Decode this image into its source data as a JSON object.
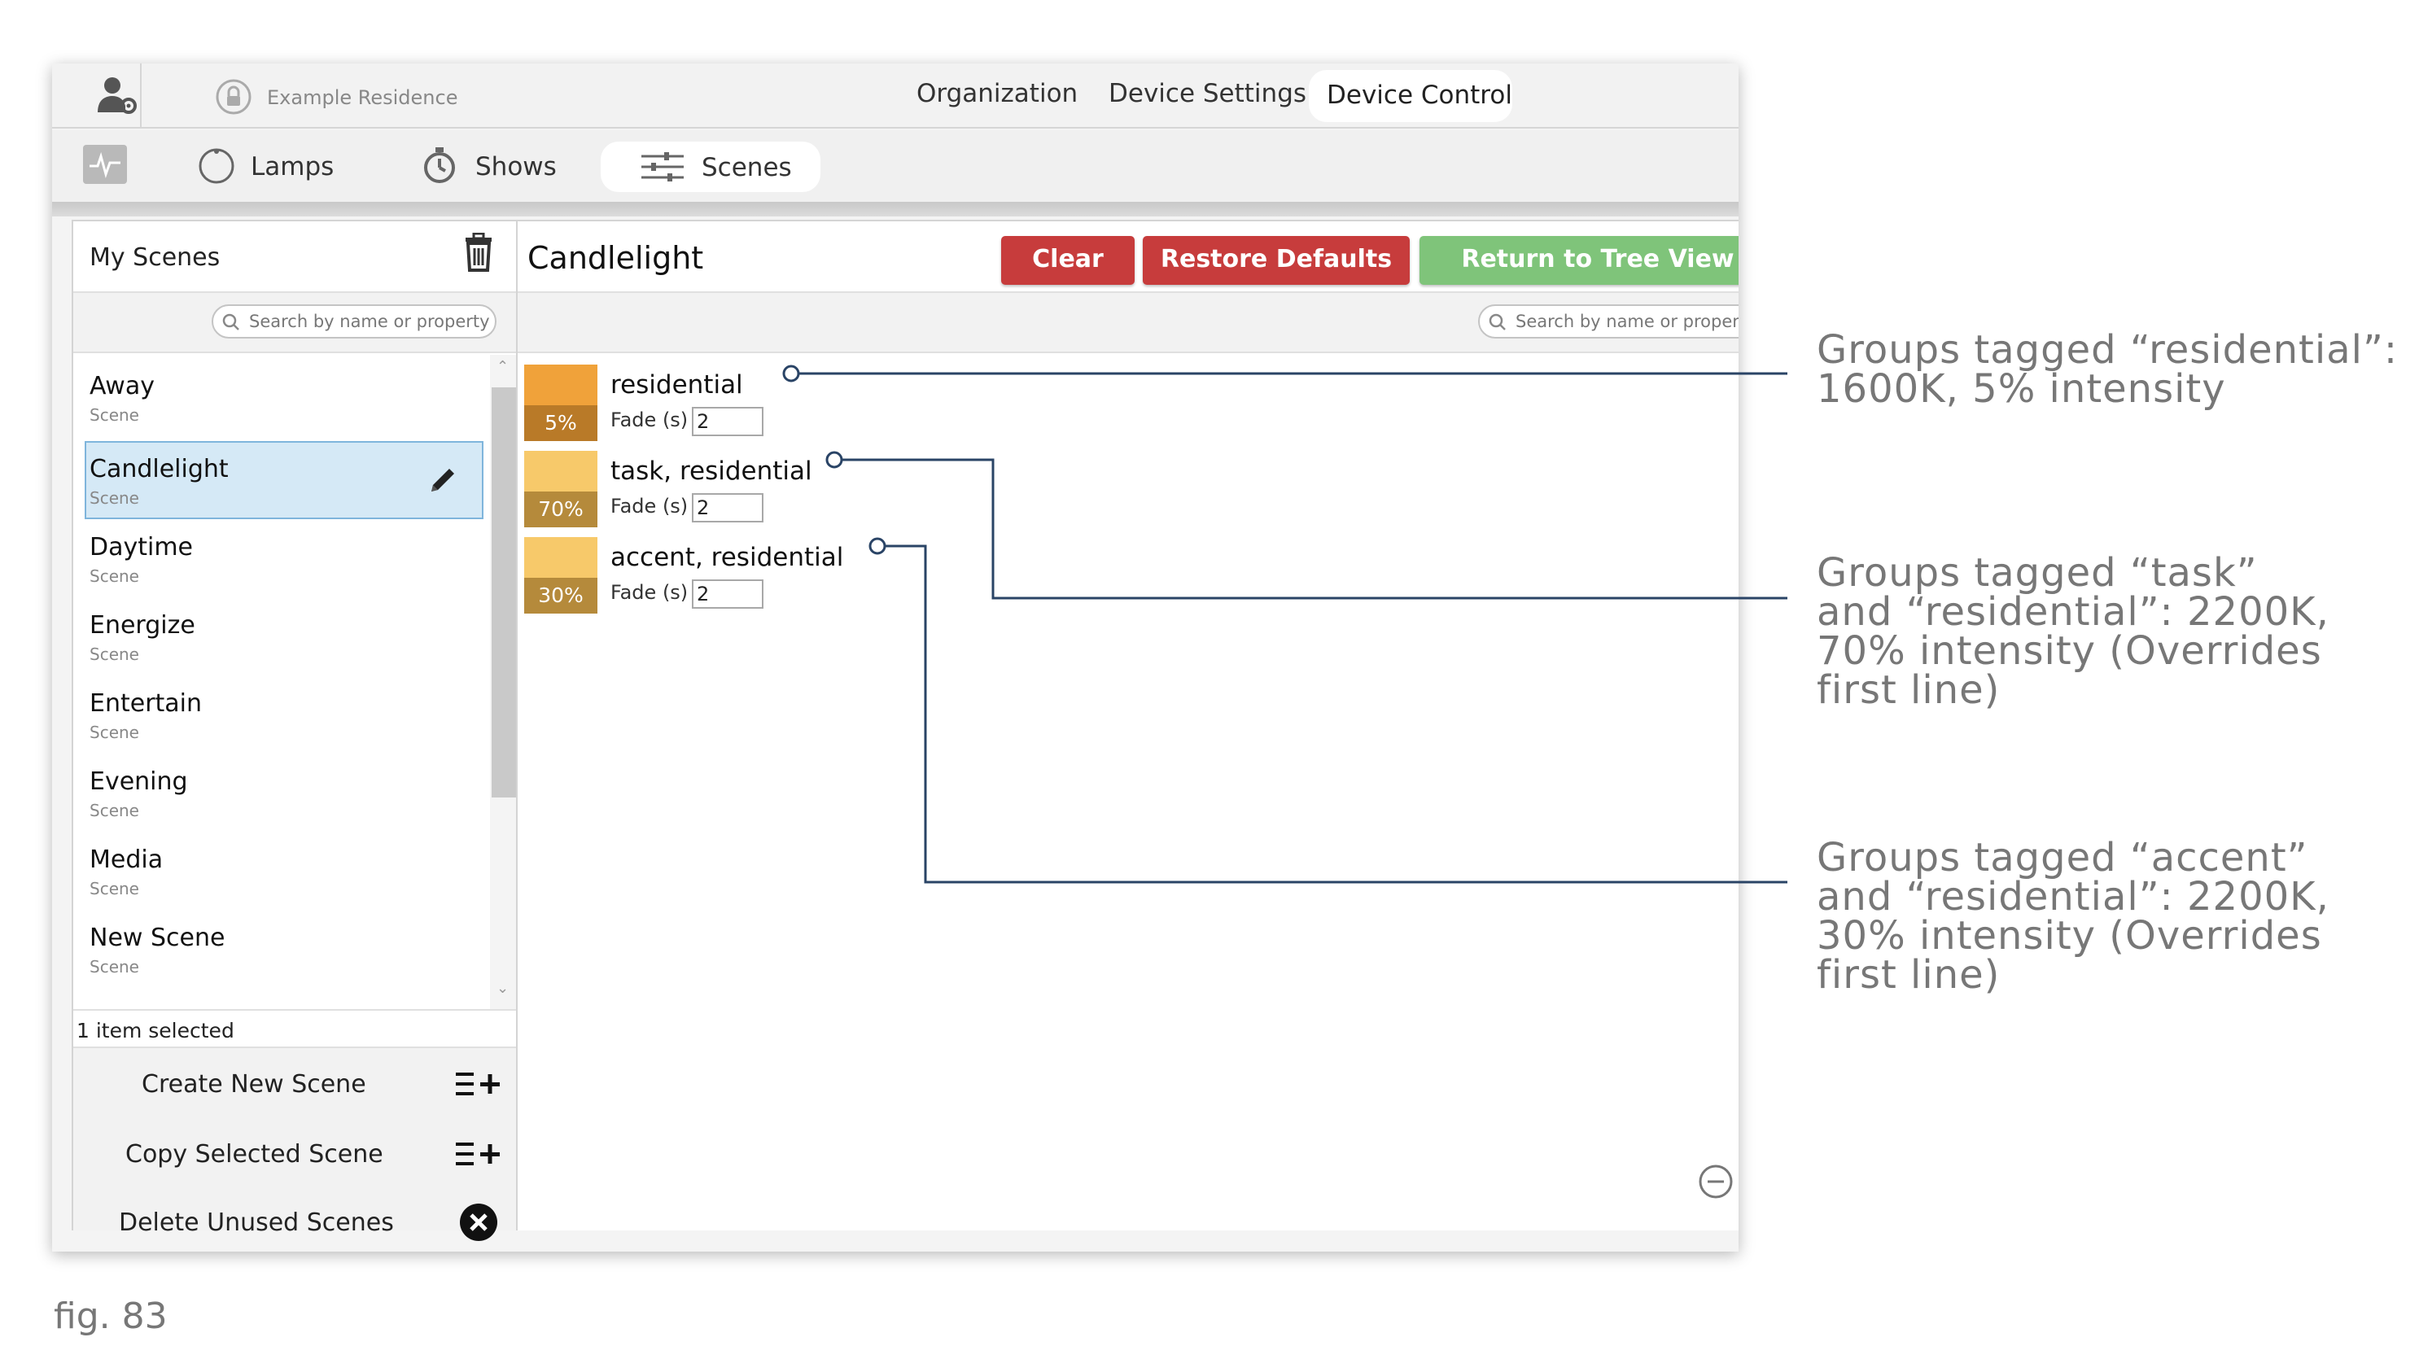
{
  "topbar": {
    "residence": "Example Residence",
    "tabs": [
      "Organization",
      "Device Settings",
      "Device Control"
    ],
    "active_tab": "Device Control"
  },
  "navbar": {
    "items": [
      "Lamps",
      "Shows",
      "Scenes"
    ],
    "active": "Scenes"
  },
  "left_panel": {
    "title": "My Scenes",
    "search_placeholder": "Search by name or property",
    "scenes": [
      {
        "name": "Away",
        "type": "Scene"
      },
      {
        "name": "Candlelight",
        "type": "Scene"
      },
      {
        "name": "Daytime",
        "type": "Scene"
      },
      {
        "name": "Energize",
        "type": "Scene"
      },
      {
        "name": "Entertain",
        "type": "Scene"
      },
      {
        "name": "Evening",
        "type": "Scene"
      },
      {
        "name": "Media",
        "type": "Scene"
      },
      {
        "name": "New Scene",
        "type": "Scene"
      }
    ],
    "selected_scene": "Candlelight",
    "status": "1 item selected",
    "actions": [
      "Create New Scene",
      "Copy Selected Scene",
      "Delete Unused Scenes"
    ]
  },
  "main_panel": {
    "title": "Candlelight",
    "buttons": {
      "clear": "Clear",
      "restore": "Restore Defaults",
      "return": "Return to Tree View"
    },
    "search_placeholder": "Search by name or property",
    "groups": [
      {
        "tags": "residential",
        "intensity": "5%",
        "fade_label": "Fade (s)",
        "fade_value": "2",
        "swatch_color": "#f0a23a",
        "badge_color": "#b97a28"
      },
      {
        "tags": "task, residential",
        "intensity": "70%",
        "fade_label": "Fade (s)",
        "fade_value": "2",
        "swatch_color": "#f7c96a",
        "badge_color": "#b58a3b"
      },
      {
        "tags": "accent, residential",
        "intensity": "30%",
        "fade_label": "Fade (s)",
        "fade_value": "2",
        "swatch_color": "#f7c96a",
        "badge_color": "#b58a3b"
      }
    ]
  },
  "annotations": [
    {
      "lines": [
        "Groups tagged “residential”:",
        "1600K, 5% intensity"
      ]
    },
    {
      "lines": [
        "Groups tagged “task”",
        "and “residential”: 2200K,",
        "70% intensity (Overrides",
        "first line)"
      ]
    },
    {
      "lines": [
        "Groups tagged “accent”",
        "and “residential”: 2200K,",
        "30% intensity (Overrides",
        "first line)"
      ]
    }
  ],
  "caption": "fig. 83",
  "colors": {
    "clear_button": "#c73c3c",
    "restore_button": "#c73c3c",
    "return_button": "#7fc47a",
    "selected_row": "#d5e9f6",
    "leader_line": "#2a4466"
  },
  "icons": {
    "user_settings": "user-gear-icon",
    "residence": "lock-icon",
    "lamps": "circle-icon",
    "shows": "stopwatch-icon",
    "scenes": "sliders-icon",
    "monitor": "pulse-icon",
    "delete": "trash-icon",
    "edit": "pencil-icon",
    "create": "list-plus-icon",
    "delete_unused": "x-circle-icon",
    "zoom_out": "minus-circle-icon",
    "zoom_in": "plus-circle-icon"
  }
}
